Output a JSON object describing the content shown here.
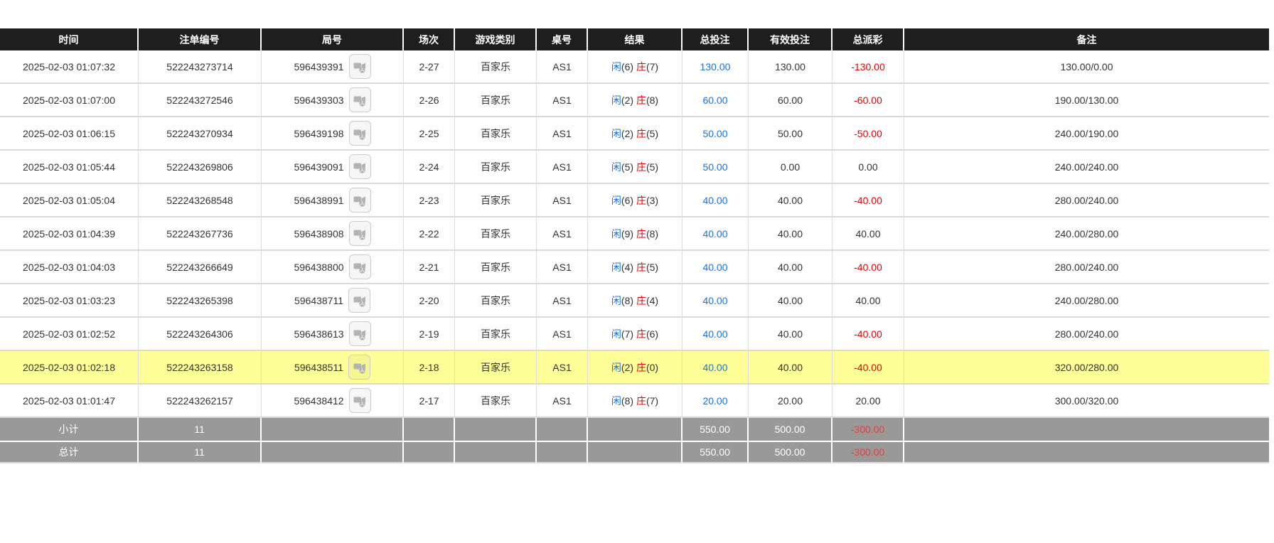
{
  "colors": {
    "header_bg": "#1e1e1e",
    "header_text": "#ffffff",
    "highlight_bg": "#ffff99",
    "footer_bg": "#999999",
    "blue": "#1673e8",
    "red": "#e60000",
    "row_border": "#d9d9d9"
  },
  "table": {
    "columns": [
      {
        "key": "time",
        "label": "时间"
      },
      {
        "key": "bet_no",
        "label": "注单编号"
      },
      {
        "key": "round_no",
        "label": "局号"
      },
      {
        "key": "session",
        "label": "场次"
      },
      {
        "key": "game",
        "label": "游戏类别"
      },
      {
        "key": "table_no",
        "label": "桌号"
      },
      {
        "key": "result",
        "label": "结果"
      },
      {
        "key": "total_bet",
        "label": "总投注"
      },
      {
        "key": "valid_bet",
        "label": "有效投注"
      },
      {
        "key": "payout",
        "label": "总派彩"
      },
      {
        "key": "remark",
        "label": "备注"
      }
    ],
    "result_labels": {
      "player": "闲",
      "banker": "庄"
    },
    "video_icon_name": "video-clip-icon",
    "rows": [
      {
        "time": "2025-02-03 01:07:32",
        "bet_no": "522243273714",
        "round_no": "596439391",
        "session": "2-27",
        "game": "百家乐",
        "table_no": "AS1",
        "player_score": "(6)",
        "banker_score": "(7)",
        "total_bet": "130.00",
        "valid_bet": "130.00",
        "payout": "-130.00",
        "remark": "130.00/0.00",
        "highlighted": false
      },
      {
        "time": "2025-02-03 01:07:00",
        "bet_no": "522243272546",
        "round_no": "596439303",
        "session": "2-26",
        "game": "百家乐",
        "table_no": "AS1",
        "player_score": "(2)",
        "banker_score": "(8)",
        "total_bet": "60.00",
        "valid_bet": "60.00",
        "payout": "-60.00",
        "remark": "190.00/130.00",
        "highlighted": false
      },
      {
        "time": "2025-02-03 01:06:15",
        "bet_no": "522243270934",
        "round_no": "596439198",
        "session": "2-25",
        "game": "百家乐",
        "table_no": "AS1",
        "player_score": "(2)",
        "banker_score": "(5)",
        "total_bet": "50.00",
        "valid_bet": "50.00",
        "payout": "-50.00",
        "remark": "240.00/190.00",
        "highlighted": false
      },
      {
        "time": "2025-02-03 01:05:44",
        "bet_no": "522243269806",
        "round_no": "596439091",
        "session": "2-24",
        "game": "百家乐",
        "table_no": "AS1",
        "player_score": "(5)",
        "banker_score": "(5)",
        "total_bet": "50.00",
        "valid_bet": "0.00",
        "payout": "0.00",
        "remark": "240.00/240.00",
        "highlighted": false
      },
      {
        "time": "2025-02-03 01:05:04",
        "bet_no": "522243268548",
        "round_no": "596438991",
        "session": "2-23",
        "game": "百家乐",
        "table_no": "AS1",
        "player_score": "(6)",
        "banker_score": "(3)",
        "total_bet": "40.00",
        "valid_bet": "40.00",
        "payout": "-40.00",
        "remark": "280.00/240.00",
        "highlighted": false
      },
      {
        "time": "2025-02-03 01:04:39",
        "bet_no": "522243267736",
        "round_no": "596438908",
        "session": "2-22",
        "game": "百家乐",
        "table_no": "AS1",
        "player_score": "(9)",
        "banker_score": "(8)",
        "total_bet": "40.00",
        "valid_bet": "40.00",
        "payout": "40.00",
        "remark": "240.00/280.00",
        "highlighted": false
      },
      {
        "time": "2025-02-03 01:04:03",
        "bet_no": "522243266649",
        "round_no": "596438800",
        "session": "2-21",
        "game": "百家乐",
        "table_no": "AS1",
        "player_score": "(4)",
        "banker_score": "(5)",
        "total_bet": "40.00",
        "valid_bet": "40.00",
        "payout": "-40.00",
        "remark": "280.00/240.00",
        "highlighted": false
      },
      {
        "time": "2025-02-03 01:03:23",
        "bet_no": "522243265398",
        "round_no": "596438711",
        "session": "2-20",
        "game": "百家乐",
        "table_no": "AS1",
        "player_score": "(8)",
        "banker_score": "(4)",
        "total_bet": "40.00",
        "valid_bet": "40.00",
        "payout": "40.00",
        "remark": "240.00/280.00",
        "highlighted": false
      },
      {
        "time": "2025-02-03 01:02:52",
        "bet_no": "522243264306",
        "round_no": "596438613",
        "session": "2-19",
        "game": "百家乐",
        "table_no": "AS1",
        "player_score": "(7)",
        "banker_score": "(6)",
        "total_bet": "40.00",
        "valid_bet": "40.00",
        "payout": "-40.00",
        "remark": "280.00/240.00",
        "highlighted": false
      },
      {
        "time": "2025-02-03 01:02:18",
        "bet_no": "522243263158",
        "round_no": "596438511",
        "session": "2-18",
        "game": "百家乐",
        "table_no": "AS1",
        "player_score": "(2)",
        "banker_score": "(0)",
        "total_bet": "40.00",
        "valid_bet": "40.00",
        "payout": "-40.00",
        "remark": "320.00/280.00",
        "highlighted": true
      },
      {
        "time": "2025-02-03 01:01:47",
        "bet_no": "522243262157",
        "round_no": "596438412",
        "session": "2-17",
        "game": "百家乐",
        "table_no": "AS1",
        "player_score": "(8)",
        "banker_score": "(7)",
        "total_bet": "20.00",
        "valid_bet": "20.00",
        "payout": "20.00",
        "remark": "300.00/320.00",
        "highlighted": false
      }
    ],
    "footer": [
      {
        "label": "小计",
        "count": "11",
        "total_bet": "550.00",
        "valid_bet": "500.00",
        "payout": "-300.00",
        "grand": false
      },
      {
        "label": "总计",
        "count": "11",
        "total_bet": "550.00",
        "valid_bet": "500.00",
        "payout": "-300.00",
        "grand": true
      }
    ]
  }
}
